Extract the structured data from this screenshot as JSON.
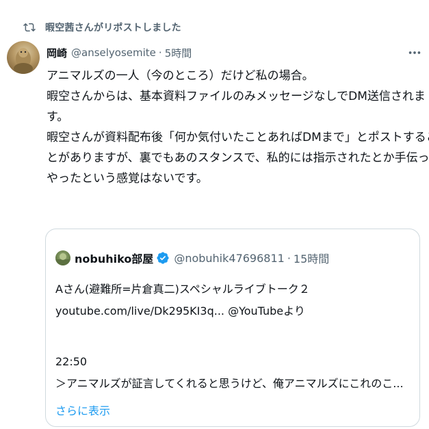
{
  "repost": {
    "icon": "repost-icon",
    "text": "暇空茜さんがリポストしました"
  },
  "tweet": {
    "author_name": "岡崎",
    "author_handle": "@anselyosemite",
    "separator": "·",
    "time": "5時間",
    "more_icon": "more-options-icon",
    "lines": [
      "アニマルズの一人（今のところ）だけど私の場合。",
      "暇空さんからは、基本資料ファイルのみメッセージなしでDM送信されま",
      "す。",
      "暇空さんが資料配布後「何か気付いたことあればDMまで」とポストするこ",
      "とがありますが、裏でもあのスタンスで、私的には指示されたとか手伝って",
      "やったという感覚はないです。"
    ]
  },
  "quote": {
    "author_name": "nobuhiko部屋",
    "verified_icon": "verified-badge-icon",
    "author_handle": "@nobuhik47696811",
    "separator": "·",
    "time": "15時間",
    "line1": "Aさん(避難所=片倉真二)スペシャルライブトーク２",
    "line2": "youtube.com/live/Dk295KI3q... @YouTubeより",
    "line3": "22:50",
    "line4": "＞アニマルズが証言してくれると思うけど、俺アニマルズにこれのこ...",
    "show_more": "さらに表示"
  },
  "colors": {
    "text": "#0f1419",
    "secondary": "#536471",
    "link": "#1d9bf0",
    "border": "#cfd9de"
  }
}
